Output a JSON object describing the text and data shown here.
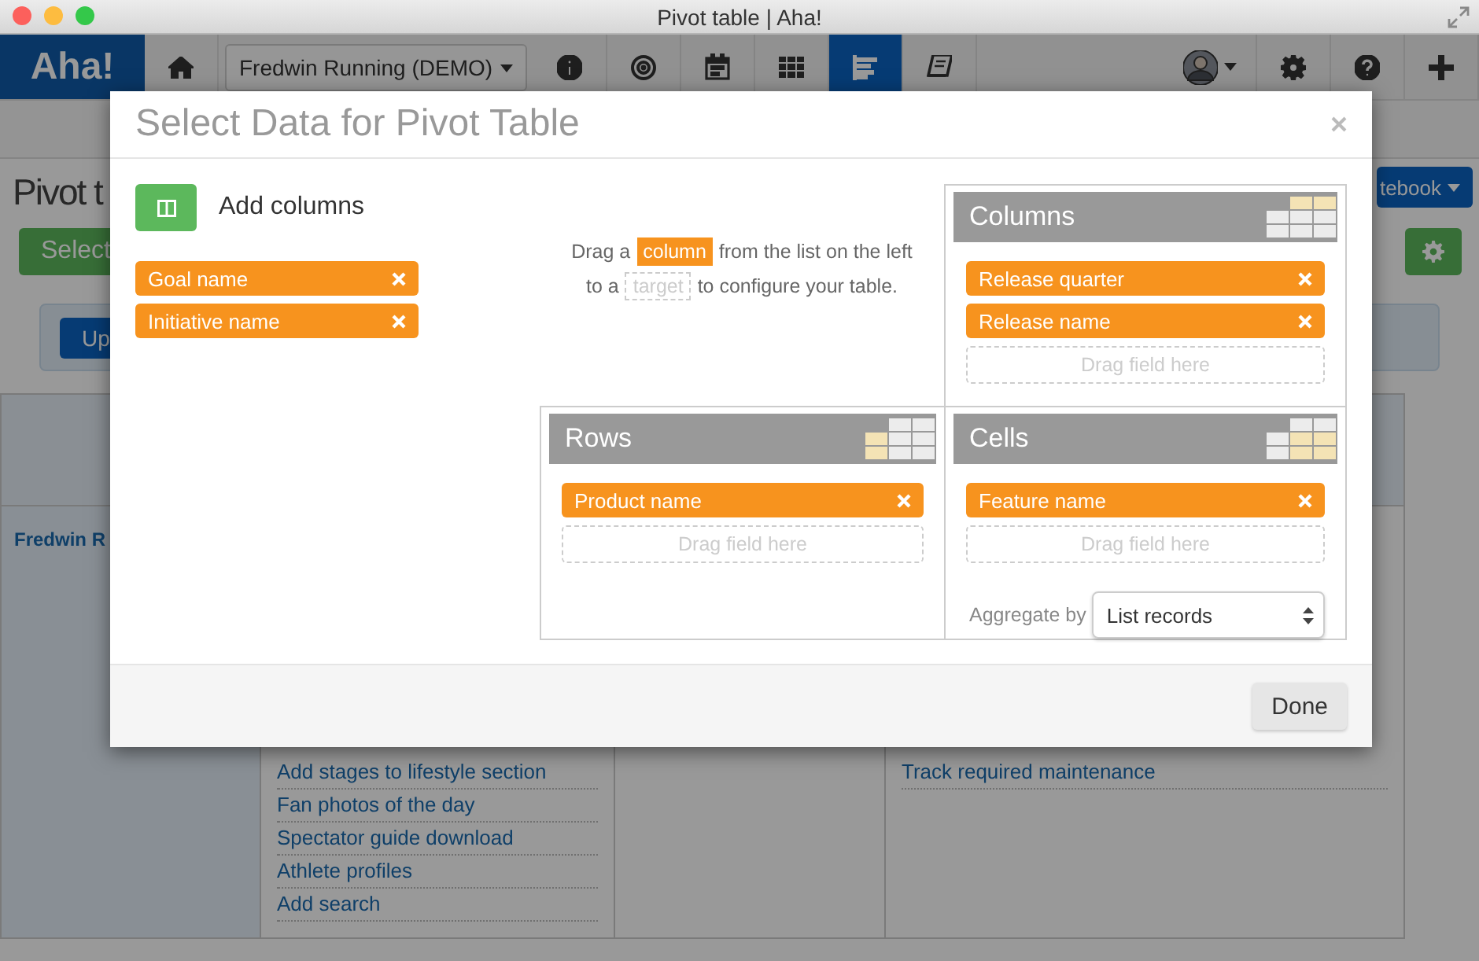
{
  "window": {
    "title": "Pivot table | Aha!"
  },
  "nav": {
    "logo": "Aha!",
    "product": "Fredwin Running (DEMO)",
    "items": [
      {
        "kind": "home",
        "selected": false
      },
      {
        "kind": "product",
        "selected": false
      },
      {
        "kind": "info",
        "selected": false
      },
      {
        "kind": "target",
        "selected": false
      },
      {
        "kind": "calendar",
        "selected": false
      },
      {
        "kind": "grid",
        "selected": false
      },
      {
        "kind": "bars",
        "selected": true
      },
      {
        "kind": "book",
        "selected": false
      }
    ],
    "right_items": [
      {
        "kind": "avatar"
      },
      {
        "kind": "gear"
      },
      {
        "kind": "help"
      },
      {
        "kind": "plus"
      }
    ]
  },
  "page": {
    "title": "Pivot t",
    "select_button": "Select",
    "update_button": "Up",
    "notebook_button": "tebook",
    "row_header": "Fredwin R",
    "features": [
      "Add stages to lifestyle section",
      "Fan photos of the day",
      "Spectator guide download",
      "Athlete profiles",
      "Add search"
    ],
    "column_4": [
      "Track required maintenance"
    ]
  },
  "dialog": {
    "title": "Select Data for Pivot Table",
    "add_columns": "Add columns",
    "available_fields": [
      "Goal name",
      "Initiative name"
    ],
    "instructions": [
      {
        "before": "Drag a",
        "chip": "column",
        "after": "from the list on the left"
      },
      {
        "before": "to a",
        "target": "target",
        "after": "to configure your table."
      }
    ],
    "zones": [
      {
        "kind": "columns",
        "title": "Columns",
        "fields": [
          "Release quarter",
          "Release name"
        ],
        "drop_hint": "Drag field here"
      },
      {
        "kind": "rows",
        "title": "Rows",
        "fields": [
          "Product name"
        ],
        "drop_hint": "Drag field here"
      },
      {
        "kind": "cells",
        "title": "Cells",
        "fields": [
          "Feature name"
        ],
        "drop_hint": "Drag field here"
      }
    ],
    "aggregate": {
      "label": "Aggregate by",
      "value": "List records"
    },
    "done_button": "Done"
  }
}
